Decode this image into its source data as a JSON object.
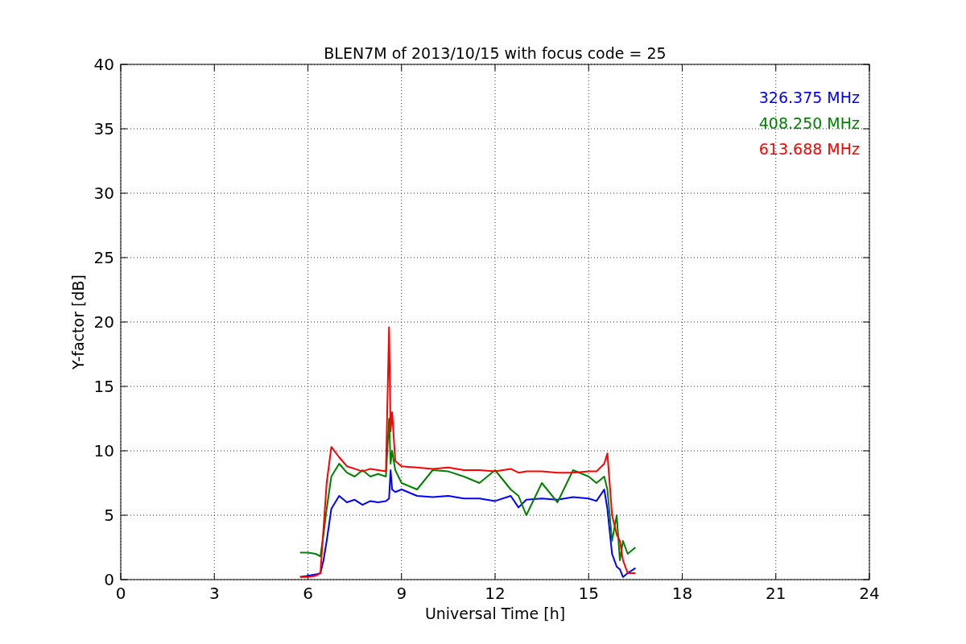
{
  "figure": {
    "chart_data": {
      "type": "line",
      "title": "BLEN7M of 2013/10/15 with focus code = 25",
      "xlabel": "Universal Time [h]",
      "ylabel": "Y-factor [dB]",
      "x": [
        5.75,
        6.0,
        6.25,
        6.4,
        6.5,
        6.6,
        6.75,
        7.0,
        7.25,
        7.5,
        7.75,
        8.0,
        8.25,
        8.5,
        8.6,
        8.65,
        8.7,
        8.8,
        9.0,
        9.5,
        10,
        10.5,
        11,
        11.5,
        12,
        12.5,
        12.75,
        13,
        13.5,
        14,
        14.5,
        15,
        15.25,
        15.5,
        15.6,
        15.75,
        15.9,
        16.0,
        16.1,
        16.25,
        16.5
      ],
      "series": [
        {
          "name": "326.375 MHz",
          "color": "#0000ff",
          "values": [
            0.2,
            0.3,
            0.4,
            0.5,
            1.5,
            3,
            5.5,
            6.5,
            6.0,
            6.2,
            5.8,
            6.1,
            6.0,
            6.1,
            6.3,
            8.5,
            7.0,
            6.8,
            7.0,
            6.5,
            6.4,
            6.5,
            6.3,
            6.3,
            6.1,
            6.5,
            5.6,
            6.2,
            6.3,
            6.2,
            6.4,
            6.3,
            6.1,
            7.0,
            5.5,
            2.0,
            1.0,
            0.8,
            0.2,
            0.5,
            0.9
          ]
        },
        {
          "name": "408.250 MHz",
          "color": "#008000",
          "values": [
            2.1,
            2.1,
            2.0,
            1.8,
            3.5,
            5.5,
            8.0,
            9.0,
            8.3,
            8.0,
            8.5,
            8.0,
            8.2,
            8.0,
            12.5,
            9.0,
            10.0,
            8.5,
            7.5,
            7.0,
            8.5,
            8.4,
            8.0,
            7.5,
            8.5,
            7.0,
            6.5,
            5.0,
            7.5,
            6.0,
            8.5,
            8.0,
            7.5,
            8.0,
            7.0,
            3.0,
            5.0,
            1.5,
            3.0,
            2.0,
            2.5
          ]
        },
        {
          "name": "613.688 MHz",
          "color": "#ff0000",
          "values": [
            0.2,
            0.2,
            0.3,
            0.5,
            4.0,
            7.5,
            10.3,
            9.5,
            8.8,
            8.6,
            8.4,
            8.6,
            8.5,
            8.4,
            19.6,
            11.5,
            13.0,
            9.2,
            8.8,
            8.7,
            8.6,
            8.7,
            8.5,
            8.5,
            8.4,
            8.6,
            8.3,
            8.4,
            8.4,
            8.3,
            8.3,
            8.4,
            8.4,
            9.0,
            9.8,
            5.0,
            3.5,
            3.0,
            1.5,
            0.5,
            0.5
          ]
        }
      ],
      "grid": true,
      "xlim": [
        0,
        24
      ],
      "ylim": [
        0,
        40
      ],
      "xticks": [
        0,
        3,
        6,
        9,
        12,
        15,
        18,
        21,
        24
      ],
      "yticks": [
        0,
        5,
        10,
        15,
        20,
        25,
        30,
        35,
        40
      ]
    }
  }
}
